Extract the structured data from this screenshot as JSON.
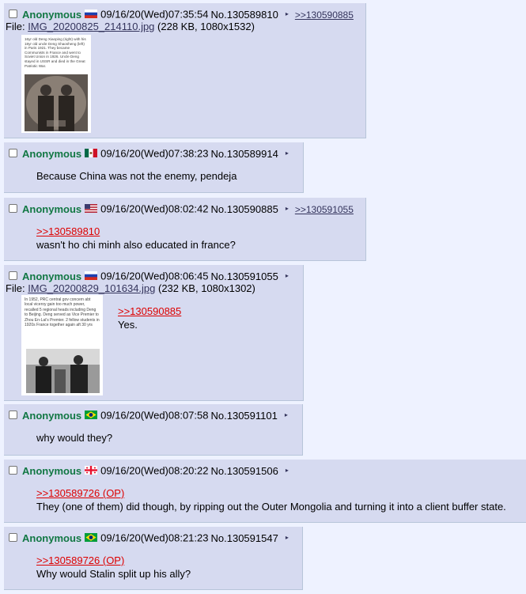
{
  "colors": {
    "page_bg": "#eef2ff",
    "post_bg": "#d6daf0",
    "name": "#117743",
    "quote": "#dd0000",
    "link": "#34345c"
  },
  "posts": [
    {
      "name": "Anonymous",
      "flag_icon": "russia-flag-icon",
      "datetime": "09/16/20(Wed)07:35:54",
      "number": "No.130589810",
      "menu": "▸",
      "backlinks": [
        ">>130590885"
      ],
      "file": {
        "label": "File:",
        "name": "IMG_20200825_214110.jpg",
        "meta": " (228 KB, 1080x1532)",
        "thumb_caption": "16yr old Deng Xiaoping (right) with his 18yr old uncle Deng Shaosheng (left) in Paris 1921. They became Communists in France and went to Soviet Union in 1926. Uncle Deng stayed in USSR and died in the Great Patriotic War."
      },
      "lines": []
    },
    {
      "name": "Anonymous",
      "flag_icon": "mexico-flag-icon",
      "datetime": "09/16/20(Wed)07:38:23",
      "number": "No.130589914",
      "menu": "▸",
      "backlinks": [],
      "lines": [
        "Because China was not the enemy, pendeja"
      ]
    },
    {
      "name": "Anonymous",
      "flag_icon": "usa-flag-icon",
      "datetime": "09/16/20(Wed)08:02:42",
      "number": "No.130590885",
      "menu": "▸",
      "backlinks": [
        ">>130591055"
      ],
      "quote": ">>130589810",
      "lines": [
        "wasn't ho chi minh also educated in france?"
      ]
    },
    {
      "name": "Anonymous",
      "flag_icon": "russia-flag-icon",
      "datetime": "09/16/20(Wed)08:06:45",
      "number": "No.130591055",
      "menu": "▸",
      "backlinks": [],
      "file": {
        "label": "File:",
        "name": "IMG_20200829_101634.jpg",
        "meta": " (232 KB, 1080x1302)",
        "thumb_caption": "In 1952, PRC central gov concern abt local viceroy gain too much power, recalled 5 regional heads including Deng to Beijing. Deng served as Vice Premier to Zhou En-Lai's Premier. 2 fellow students in 1920s France together again aft 30 yrs"
      },
      "quote": ">>130590885",
      "lines": [
        "Yes."
      ]
    },
    {
      "name": "Anonymous",
      "flag_icon": "brazil-flag-icon",
      "datetime": "09/16/20(Wed)08:07:58",
      "number": "No.130591101",
      "menu": "▸",
      "backlinks": [],
      "lines": [
        "why would they?"
      ]
    },
    {
      "name": "Anonymous",
      "flag_icon": "georgia-flag-icon",
      "datetime": "09/16/20(Wed)08:20:22",
      "number": "No.130591506",
      "menu": "▸",
      "backlinks": [],
      "quote": ">>130589726 (OP)",
      "lines": [
        "They (one of them) did though, by ripping out the Outer Mongolia and turning it into a client buffer state."
      ]
    },
    {
      "name": "Anonymous",
      "flag_icon": "brazil-flag-icon",
      "datetime": "09/16/20(Wed)08:21:23",
      "number": "No.130591547",
      "menu": "▸",
      "backlinks": [],
      "quote": ">>130589726 (OP)",
      "lines": [
        "Why would Stalin split up his ally?"
      ]
    }
  ]
}
